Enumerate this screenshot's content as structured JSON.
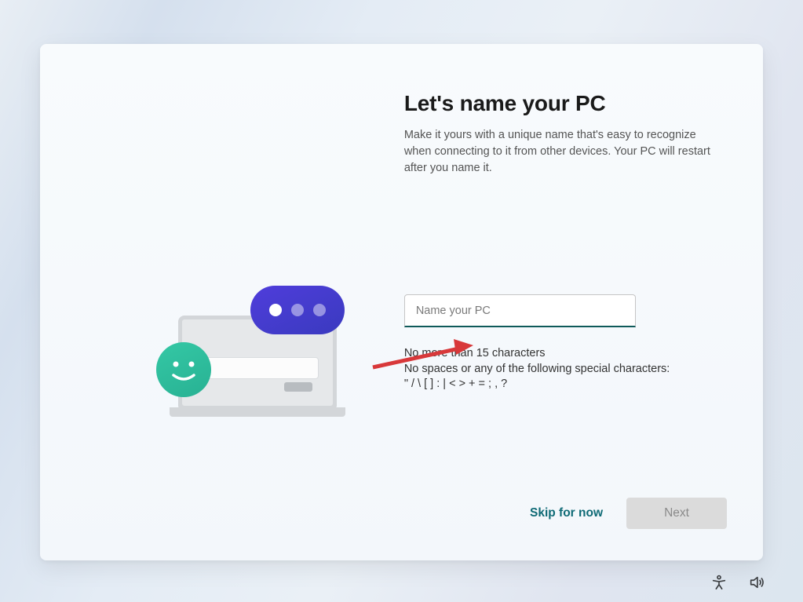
{
  "page": {
    "title": "Let's name your PC",
    "subtitle": "Make it yours with a unique name that's easy to recognize when connecting to it from other devices. Your PC will restart after you name it."
  },
  "input": {
    "placeholder": "Name your PC",
    "value": ""
  },
  "hints": {
    "line1": "No more than 15 characters",
    "line2": "No spaces or any of the following special characters:",
    "line3": "\" / \\ [ ] : | < > + = ; , ?"
  },
  "buttons": {
    "skip": "Skip for now",
    "next": "Next"
  },
  "colors": {
    "accent": "#0e6a75",
    "input_underline": "#0f5a5a",
    "arrow": "#d8383a"
  },
  "tray_icons": [
    "accessibility",
    "volume"
  ]
}
